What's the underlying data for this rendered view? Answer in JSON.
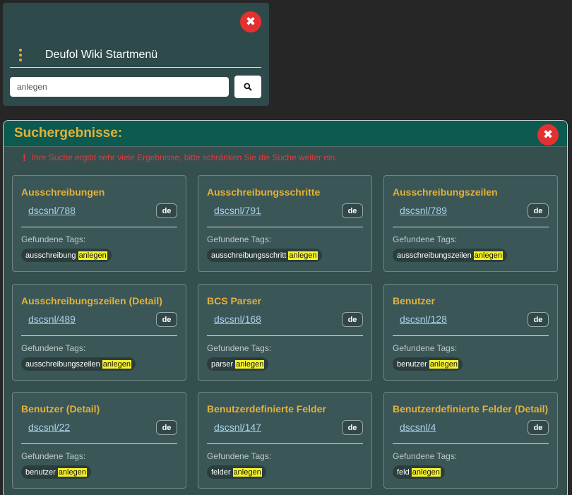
{
  "menu": {
    "title": "Deufol Wiki Startmenü",
    "search_value": "anlegen"
  },
  "results": {
    "title": "Suchergebnisse:",
    "warning": "Ihre Suche ergibt sehr viele Ergebnisse, bitte schränken Sie die Suche weiter ein.",
    "cards": [
      {
        "title": "Ausschreibungen",
        "link": "dscsnl/788",
        "lang": "de",
        "tags_label": "Gefundene Tags:",
        "tag_word": "ausschreibung",
        "tag_highlight": "anlegen"
      },
      {
        "title": "Ausschreibungsschritte",
        "link": "dscsnl/791",
        "lang": "de",
        "tags_label": "Gefundene Tags:",
        "tag_word": "ausschreibungsschritt",
        "tag_highlight": "anlegen"
      },
      {
        "title": "Ausschreibungszeilen",
        "link": "dscsnl/789",
        "lang": "de",
        "tags_label": "Gefundene Tags:",
        "tag_word": "ausschreibungszeilen",
        "tag_highlight": "anlegen"
      },
      {
        "title": "Ausschreibungszeilen (Detail)",
        "link": "dscsnl/489",
        "lang": "de",
        "tags_label": "Gefundene Tags:",
        "tag_word": "ausschreibungszeilen",
        "tag_highlight": "anlegen"
      },
      {
        "title": "BCS Parser",
        "link": "dscsnl/168",
        "lang": "de",
        "tags_label": "Gefundene Tags:",
        "tag_word": "parser",
        "tag_highlight": "anlegen"
      },
      {
        "title": "Benutzer",
        "link": "dscsnl/128",
        "lang": "de",
        "tags_label": "Gefundene Tags:",
        "tag_word": "benutzer",
        "tag_highlight": "anlegen"
      },
      {
        "title": "Benutzer (Detail)",
        "link": "dscsnl/22",
        "lang": "de",
        "tags_label": "Gefundene Tags:",
        "tag_word": "benutzer",
        "tag_highlight": "anlegen"
      },
      {
        "title": "Benutzerdefinierte Felder",
        "link": "dscsnl/147",
        "lang": "de",
        "tags_label": "Gefundene Tags:",
        "tag_word": "felder",
        "tag_highlight": "anlegen"
      },
      {
        "title": "Benutzerdefinierte Felder (Detail)",
        "link": "dscsnl/4",
        "lang": "de",
        "tags_label": "Gefundene Tags:",
        "tag_word": "feld",
        "tag_highlight": "anlegen"
      }
    ]
  },
  "icons": {
    "close": "close-icon",
    "menu": "kebab-menu-icon",
    "search": "search-icon",
    "warning": "warning-icon"
  },
  "colors": {
    "accent": "#e2b23b",
    "close_red": "#e53030",
    "warning_red": "#e23c3c",
    "header_teal": "#0c5a50",
    "highlight": "#f7f32a"
  }
}
